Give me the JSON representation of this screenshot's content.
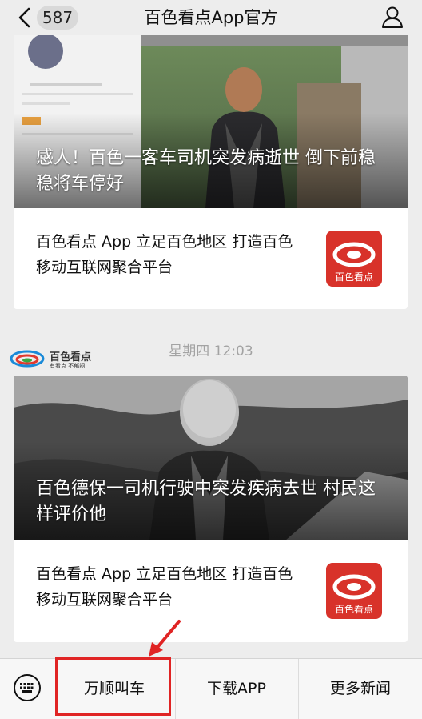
{
  "header": {
    "back_label": "back",
    "unread_count": "587",
    "title": "百色看点App官方",
    "profile_icon": "person-outline-icon"
  },
  "articles": [
    {
      "headline": "感人！百色一客车司机突发病逝世 倒下前稳稳将车停好",
      "subtitle": "百色看点 App 立足百色地区 打造百色移动互联网聚合平台",
      "logo_text": "百色看点"
    },
    {
      "headline": "百色德保一司机行驶中突发疾病去世 村民这样评价他",
      "subtitle": "百色看点 App 立足百色地区 打造百色移动互联网聚合平台",
      "logo_text": "百色看点"
    }
  ],
  "timestamp": "星期四 12:03",
  "watermark": {
    "name": "百色看点",
    "slogan": "有看点 不郁闷"
  },
  "menu": {
    "keyboard_icon": "keyboard-icon",
    "items": [
      "万顺叫车",
      "下载APP",
      "更多新闻"
    ]
  },
  "colors": {
    "highlight": "#e02424",
    "logo_red": "#d8322a",
    "background": "#ededed"
  }
}
